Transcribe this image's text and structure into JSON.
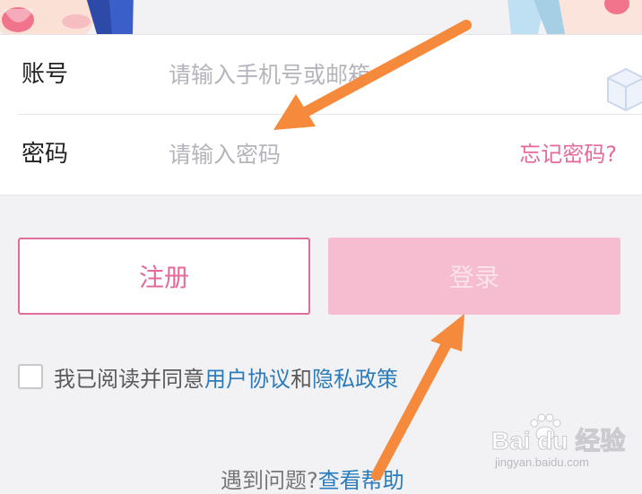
{
  "form": {
    "account_label": "账号",
    "account_placeholder": "请输入手机号或邮箱",
    "password_label": "密码",
    "password_placeholder": "请输入密码",
    "forgot_label": "忘记密码?"
  },
  "buttons": {
    "register_label": "注册",
    "login_label": "登录"
  },
  "agreement": {
    "prefix": "我已阅读并同意",
    "terms_link": "用户协议",
    "conjunction": "和",
    "privacy_link": "隐私政策",
    "checked": false
  },
  "help": {
    "prefix": "遇到问题?",
    "link": "查看帮助"
  },
  "watermark": {
    "brand": "Bai du 经验",
    "url": "jingyan.baidu.com"
  },
  "colors": {
    "accent_pink": "#e46a99",
    "login_disabled_bg": "#f6bccf",
    "link_blue": "#2c7cb9",
    "annotation_arrow": "#f58a3c"
  },
  "icons": [
    "cube-icon",
    "checkbox-icon",
    "paw-icon"
  ]
}
